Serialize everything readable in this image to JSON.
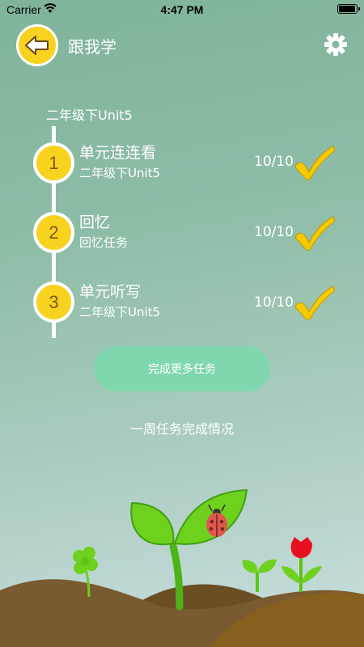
{
  "status_bar": {
    "carrier": "Carrier",
    "time": "4:47 PM"
  },
  "header": {
    "title": "跟我学",
    "back_icon": "back-arrow-icon",
    "settings_icon": "gear-icon"
  },
  "course_label": "二年级下Unit5",
  "tasks": [
    {
      "number": "1",
      "title": "单元连连看",
      "subtitle": "二年级下Unit5",
      "score": "10/10",
      "completed": true
    },
    {
      "number": "2",
      "title": "回忆",
      "subtitle": "回忆任务",
      "score": "10/10",
      "completed": true
    },
    {
      "number": "3",
      "title": "单元听写",
      "subtitle": "二年级下Unit5",
      "score": "10/10",
      "completed": true
    }
  ],
  "more_tasks_button": "完成更多任务",
  "weekly_summary_link": "一周任务完成情况",
  "colors": {
    "accent_yellow": "#f7d21f",
    "button_green": "#80d7ae",
    "leaf_green": "#6ed11e",
    "soil_brown": "#7a5a30"
  }
}
